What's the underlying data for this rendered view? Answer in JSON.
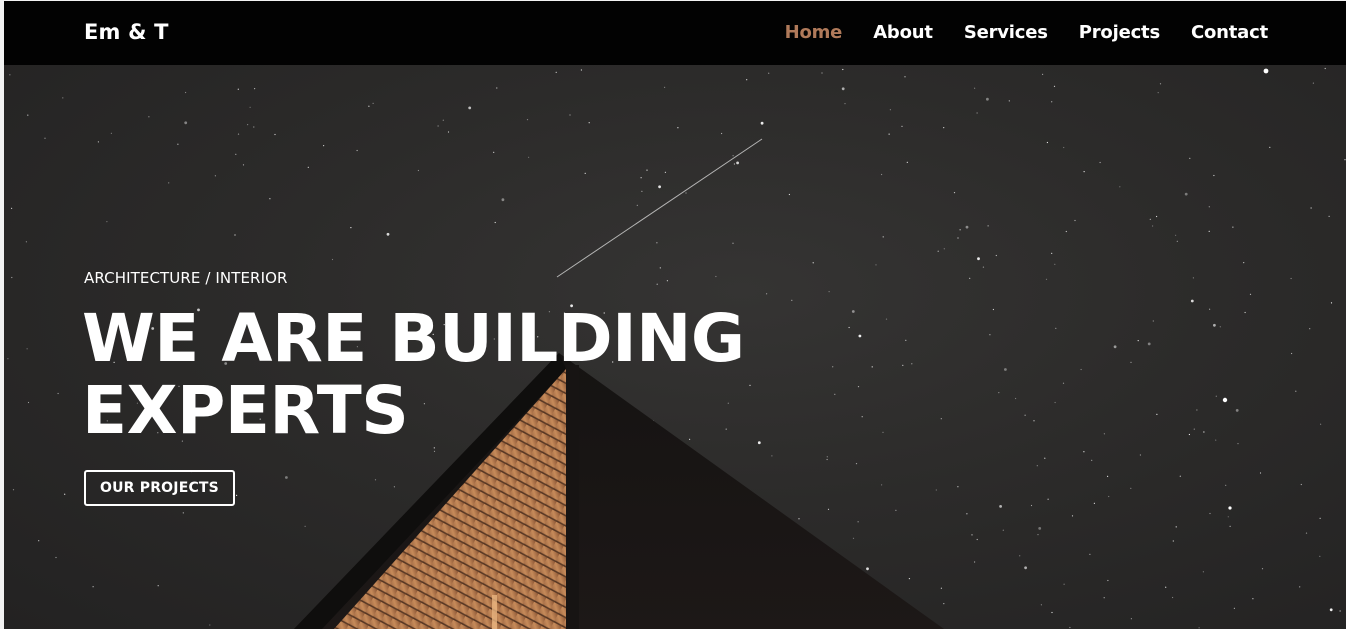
{
  "navbar": {
    "logo": "Em & T",
    "links": [
      {
        "label": "Home",
        "active": true
      },
      {
        "label": "About",
        "active": false
      },
      {
        "label": "Services",
        "active": false
      },
      {
        "label": "Projects",
        "active": false
      },
      {
        "label": "Contact",
        "active": false
      }
    ]
  },
  "hero": {
    "eyebrow": "ARCHITECTURE / INTERIOR",
    "headline_line1": "WE ARE BUILDING",
    "headline_line2": "EXPERTS",
    "cta_label": "OUR PROJECTS"
  },
  "colors": {
    "nav_background": "#020202",
    "active_link": "#b07a5a",
    "hero_background": "#2c2b2a",
    "text": "#ffffff"
  }
}
